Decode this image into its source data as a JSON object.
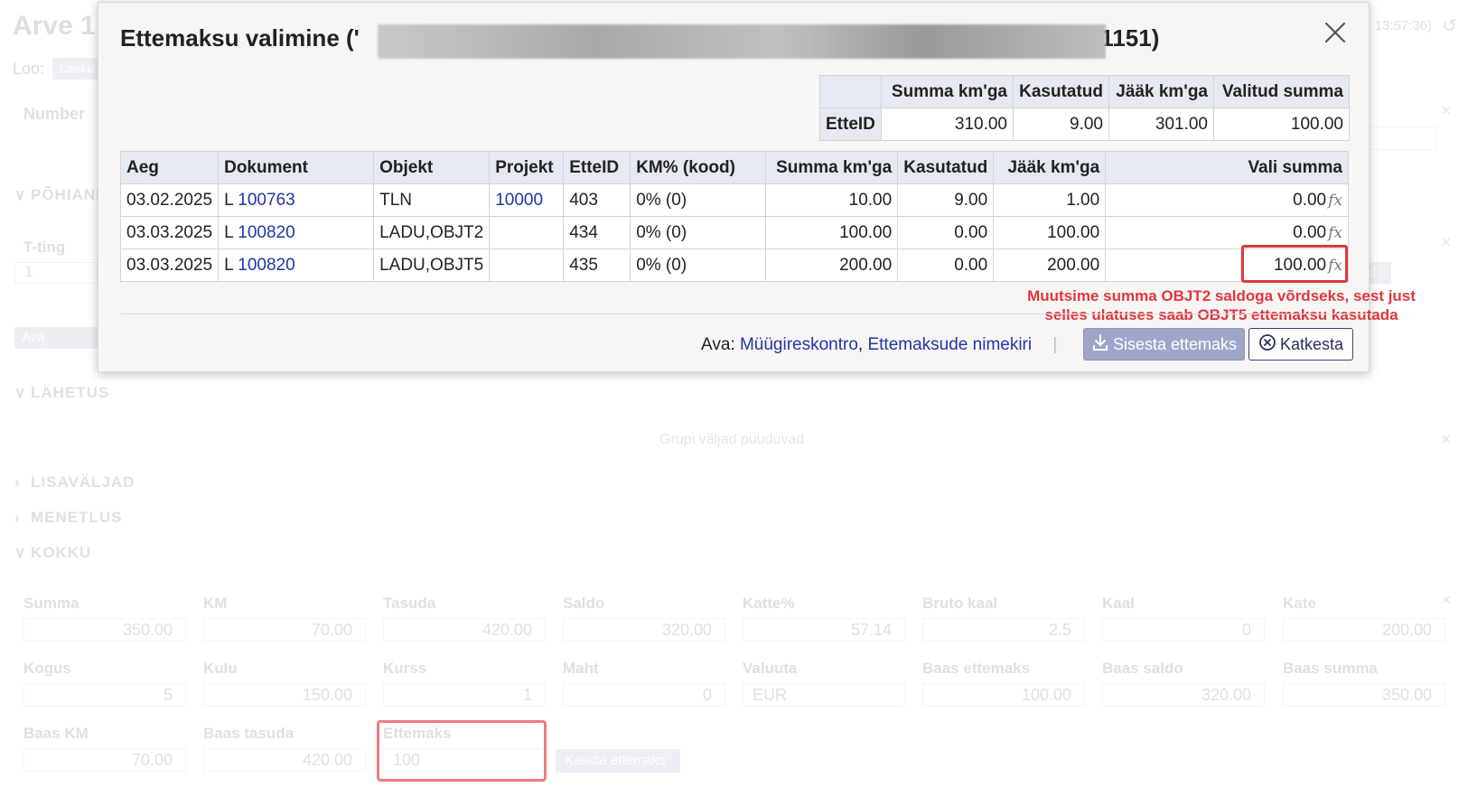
{
  "background": {
    "title": "Arve 1",
    "time": "13:57:36)",
    "loo_label": "Loo:",
    "loo_chip": "Laeku",
    "number_label": "Number",
    "sections": {
      "pohiandmed": "PÕHIAND",
      "lahetus": "LÄHETUS",
      "lisavaljad": "LISAVÄLJAD",
      "menetlus": "MENETLUS",
      "kokku": "KOKKU"
    },
    "tting_label": "T-ting",
    "tting_value": "1",
    "ava_button": "Ava makseg",
    "sid_button": "sid",
    "grupi": "Grupi väljad puuduvad",
    "fields_row1": [
      {
        "label": "Summa",
        "value": "350.00"
      },
      {
        "label": "KM",
        "value": "70.00"
      },
      {
        "label": "Tasuda",
        "value": "420.00"
      },
      {
        "label": "Saldo",
        "value": "320.00"
      },
      {
        "label": "Katte%",
        "value": "57.14"
      },
      {
        "label": "Bruto kaal",
        "value": "2.5"
      },
      {
        "label": "Kaal",
        "value": "0"
      },
      {
        "label": "Kate",
        "value": "200.00"
      }
    ],
    "fields_row2": [
      {
        "label": "Kogus",
        "value": "5"
      },
      {
        "label": "Kulu",
        "value": "150.00"
      },
      {
        "label": "Kurss",
        "value": "1"
      },
      {
        "label": "Maht",
        "value": "0"
      },
      {
        "label": "Valuuta",
        "value": "EUR"
      },
      {
        "label": "Baas ettemaks",
        "value": "100.00"
      },
      {
        "label": "Baas saldo",
        "value": "320.00"
      },
      {
        "label": "Baas summa",
        "value": "350.00"
      }
    ],
    "fields_row3": [
      {
        "label": "Baas KM",
        "value": "70.00"
      },
      {
        "label": "Baas tasuda",
        "value": "420.00"
      },
      {
        "label": "Ettemaks",
        "value": "100"
      }
    ],
    "kasuta_button": "Kasuta ettemaks"
  },
  "dialog": {
    "title_prefix": "Ettemaksu valimine ('",
    "title_suffix": ", 1151)",
    "summary": {
      "headers": [
        "Summa km'ga",
        "Kasutatud",
        "Jääk km'ga",
        "Valitud summa"
      ],
      "row_label": "EtteID",
      "values": [
        "310.00",
        "9.00",
        "301.00",
        "100.00"
      ]
    },
    "table": {
      "headers": [
        "Aeg",
        "Dokument",
        "Objekt",
        "Projekt",
        "EtteID",
        "KM% (kood)",
        "Summa km'ga",
        "Kasutatud",
        "Jääk km'ga",
        "Vali summa"
      ],
      "rows": [
        {
          "aeg": "03.02.2025",
          "doc_prefix": "L",
          "doc_link": "100763",
          "objekt": "TLN",
          "projekt": "10000",
          "etteid": "403",
          "km": "0% (0)",
          "summa": "10.00",
          "kasutatud": "9.00",
          "jaak": "1.00",
          "vali": "0.00"
        },
        {
          "aeg": "03.03.2025",
          "doc_prefix": "L",
          "doc_link": "100820",
          "objekt": "LADU,OBJT2",
          "projekt": "",
          "etteid": "434",
          "km": "0% (0)",
          "summa": "100.00",
          "kasutatud": "0.00",
          "jaak": "100.00",
          "vali": "0.00"
        },
        {
          "aeg": "03.03.2025",
          "doc_prefix": "L",
          "doc_link": "100820",
          "objekt": "LADU,OBJT5",
          "projekt": "",
          "etteid": "435",
          "km": "0% (0)",
          "summa": "200.00",
          "kasutatud": "0.00",
          "jaak": "200.00",
          "vali": "100.00"
        }
      ]
    },
    "fx_label": "fx",
    "annotation_line1": "Muutsime summa OBJT2 saldoga võrdseks, sest just",
    "annotation_line2": "selles ulatuses saab OBJT5 ettemaksu kasutada",
    "footer": {
      "ava_label": "Ava:",
      "link1": "Müügireskontro",
      "comma": ",",
      "link2": "Ettemaksude nimekiri",
      "sep": "|"
    },
    "btn_sisesta": "Sisesta ettemaks",
    "btn_katkesta": "Katkesta"
  }
}
